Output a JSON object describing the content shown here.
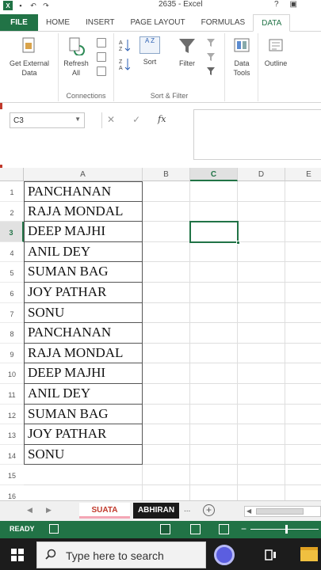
{
  "window": {
    "title": "2635 - Excel",
    "help": "?",
    "logo": "X"
  },
  "ribbon_tabs": [
    "FILE",
    "HOME",
    "INSERT",
    "PAGE LAYOUT",
    "FORMULAS",
    "DATA"
  ],
  "active_tab": "DATA",
  "ribbon": {
    "get_external_data": "Get External Data",
    "refresh_all": "Refresh All",
    "connections_group": "Connections",
    "sort_az": "A Z",
    "sort": "Sort",
    "filter": "Filter",
    "sort_filter_group": "Sort & Filter",
    "data_tools": "Data Tools",
    "outline": "Outline"
  },
  "formula_bar": {
    "name_box": "C3",
    "cancel": "✕",
    "enter": "✓",
    "fx": "fx",
    "value": ""
  },
  "columns": [
    "A",
    "B",
    "C",
    "D",
    "E"
  ],
  "selected_cell": "C3",
  "rows": [
    {
      "n": "1",
      "a": "PANCHANAN"
    },
    {
      "n": "2",
      "a": "RAJA MONDAL"
    },
    {
      "n": "3",
      "a": "DEEP MAJHI"
    },
    {
      "n": "4",
      "a": "ANIL DEY"
    },
    {
      "n": "5",
      "a": "SUMAN BAG"
    },
    {
      "n": "6",
      "a": "JOY PATHAR"
    },
    {
      "n": "7",
      "a": "SONU"
    },
    {
      "n": "8",
      "a": "PANCHANAN"
    },
    {
      "n": "9",
      "a": "RAJA MONDAL"
    },
    {
      "n": "10",
      "a": "DEEP MAJHI"
    },
    {
      "n": "11",
      "a": "ANIL DEY"
    },
    {
      "n": "12",
      "a": "SUMAN BAG"
    },
    {
      "n": "13",
      "a": "JOY PATHAR"
    },
    {
      "n": "14",
      "a": "SONU"
    },
    {
      "n": "15",
      "a": ""
    },
    {
      "n": "16",
      "a": ""
    }
  ],
  "sheets": [
    "SUATA",
    "ABHIRAN"
  ],
  "sheet_more": "...",
  "status": {
    "ready": "READY"
  },
  "taskbar": {
    "search_placeholder": "Type here to search"
  },
  "colors": {
    "excel_green": "#217346",
    "taskbar": "#1c1c1c"
  }
}
